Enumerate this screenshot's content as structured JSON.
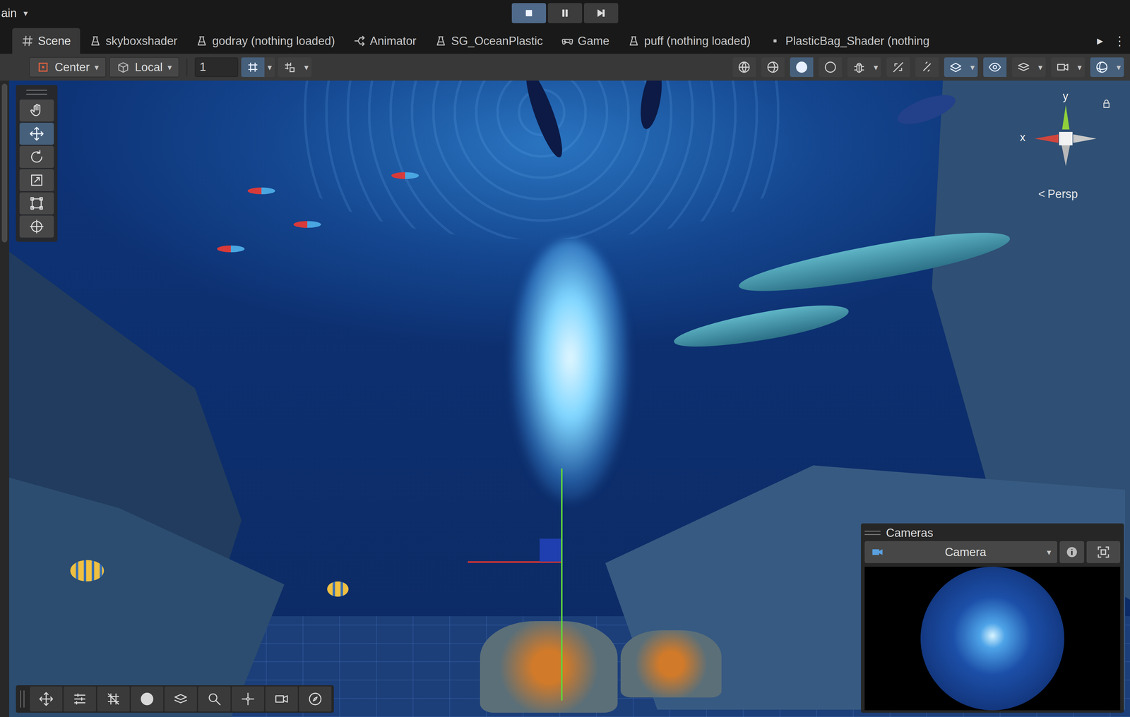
{
  "layout_menu": {
    "label": "ain",
    "arrow": "▾"
  },
  "play_controls": [
    {
      "kind": "stop",
      "selected": true
    },
    {
      "kind": "pause",
      "selected": false
    },
    {
      "kind": "step",
      "selected": false
    }
  ],
  "tabs": [
    {
      "label": "Scene",
      "kind": "scene",
      "selected": true
    },
    {
      "label": "skyboxshader",
      "kind": "shader",
      "selected": false
    },
    {
      "label": "godray (nothing loaded)",
      "kind": "shader",
      "selected": false
    },
    {
      "label": "Animator",
      "kind": "animator",
      "selected": false
    },
    {
      "label": "SG_OceanPlastic",
      "kind": "shader",
      "selected": false
    },
    {
      "label": "Game",
      "kind": "game",
      "selected": false
    },
    {
      "label": "puff (nothing loaded)",
      "kind": "shader",
      "selected": false
    },
    {
      "label": "PlasticBag_Shader (nothing",
      "kind": "dot",
      "selected": false
    }
  ],
  "tab_overflow": "▶",
  "tab_menu": "⋮",
  "toolbar": {
    "pivot": {
      "label": "Center",
      "arrow": "▾"
    },
    "space": {
      "label": "Local",
      "arrow": "▾"
    },
    "increment": "1"
  },
  "left_toggles": [
    {
      "kind": "gridsnap",
      "selected": true,
      "arrow": "▾"
    },
    {
      "kind": "snap",
      "selected": false,
      "arrow": "▾"
    }
  ],
  "view_buttons": [
    {
      "kind": "globe",
      "selected": false,
      "arrow": ""
    },
    {
      "kind": "halfglobe",
      "selected": false,
      "arrow": ""
    },
    {
      "kind": "shaded",
      "selected": true,
      "arrow": ""
    },
    {
      "kind": "unlit",
      "selected": false,
      "arrow": ""
    },
    {
      "kind": "bug",
      "selected": false,
      "arrow": "▾"
    },
    {
      "kind": "twod",
      "selected": false,
      "arrow": ""
    },
    {
      "kind": "light",
      "selected": false,
      "arrow": ""
    },
    {
      "kind": "effects",
      "selected": true,
      "arrow": "▾"
    },
    {
      "kind": "eye",
      "selected": true,
      "arrow": ""
    },
    {
      "kind": "layers",
      "selected": false,
      "arrow": "▾"
    },
    {
      "kind": "camera",
      "selected": false,
      "arrow": "▾"
    },
    {
      "kind": "orbit",
      "selected": true,
      "arrow": "▾"
    }
  ],
  "tools": [
    {
      "kind": "hand",
      "selected": false
    },
    {
      "kind": "move",
      "selected": true
    },
    {
      "kind": "rotate",
      "selected": false
    },
    {
      "kind": "scale",
      "selected": false
    },
    {
      "kind": "rect",
      "selected": false
    },
    {
      "kind": "transform",
      "selected": false
    }
  ],
  "gizmo": {
    "y": "y",
    "x": "x",
    "chevron": "<",
    "projection": "Persp",
    "locked": true
  },
  "overlay_toolbar": [
    {
      "kind": "move"
    },
    {
      "kind": "sliders"
    },
    {
      "kind": "gridoff"
    },
    {
      "kind": "shaded"
    },
    {
      "kind": "layers"
    },
    {
      "kind": "search"
    },
    {
      "kind": "pivot"
    },
    {
      "kind": "camera"
    },
    {
      "kind": "compass"
    }
  ],
  "cameras": {
    "title": "Cameras",
    "camera": "Camera",
    "arrow": "▾"
  }
}
